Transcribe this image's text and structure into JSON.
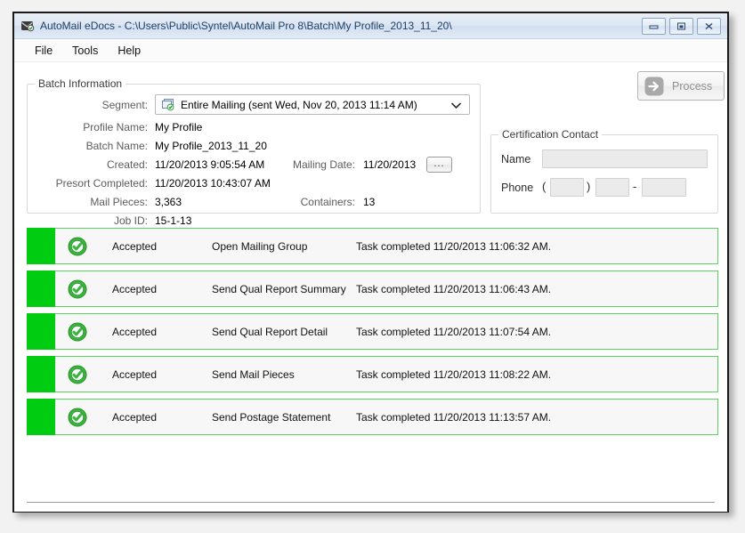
{
  "window": {
    "title": "AutoMail eDocs - C:\\Users\\Public\\Syntel\\AutoMail Pro 8\\Batch\\My Profile_2013_11_20\\",
    "app_icon": "automail-app-icon",
    "controls": {
      "minimize": "minimize-icon",
      "maximize": "restore-icon",
      "close": "close-icon"
    }
  },
  "menu": {
    "items": [
      {
        "label": "File"
      },
      {
        "label": "Tools"
      },
      {
        "label": "Help"
      }
    ]
  },
  "batch_information": {
    "title": "Batch Information",
    "segment": {
      "label": "Segment:",
      "icon": "mailing-segment-icon",
      "value": "Entire Mailing (sent Wed, Nov 20, 2013 11:14 AM)",
      "arrow_icon": "chevron-down-icon"
    },
    "fields": [
      {
        "label": "Profile Name:",
        "value": "My Profile"
      },
      {
        "label": "Batch Name:",
        "value": "My Profile_2013_11_20"
      },
      {
        "label": "Created:",
        "value": "11/20/2013 9:05:54 AM"
      },
      {
        "label": "Presort Completed:",
        "value": "11/20/2013 10:43:07 AM"
      },
      {
        "label": "Mail Pieces:",
        "value": "3,363"
      },
      {
        "label": "Job ID:",
        "value": "15-1-13"
      }
    ],
    "mailing_date": {
      "label": "Mailing Date:",
      "value": "11/20/2013",
      "browse_button": "..."
    },
    "containers": {
      "label": "Containers:",
      "value": "13"
    }
  },
  "process_button": {
    "label": "Process",
    "icon": "arrow-right-icon",
    "enabled": false
  },
  "certification_contact": {
    "title": "Certification Contact",
    "name": {
      "label": "Name",
      "value": "",
      "placeholder": ""
    },
    "phone": {
      "label": "Phone",
      "open_paren": "(",
      "close_paren": ")",
      "dash": "-",
      "area_code": "",
      "prefix": "",
      "line_number": ""
    }
  },
  "status_list": {
    "accent_color": "#00cc11",
    "border_color": "#5ecf63",
    "rows": [
      {
        "icon": "check-circle-icon",
        "status": "Accepted",
        "task": "Open Mailing Group",
        "detail": "Task completed 11/20/2013 11:06:32 AM."
      },
      {
        "icon": "check-circle-icon",
        "status": "Accepted",
        "task": "Send Qual Report Summary",
        "detail": "Task completed 11/20/2013 11:06:43 AM."
      },
      {
        "icon": "check-circle-icon",
        "status": "Accepted",
        "task": "Send Qual Report Detail",
        "detail": "Task completed 11/20/2013 11:07:54 AM."
      },
      {
        "icon": "check-circle-icon",
        "status": "Accepted",
        "task": "Send Mail Pieces",
        "detail": "Task completed 11/20/2013 11:08:22 AM."
      },
      {
        "icon": "check-circle-icon",
        "status": "Accepted",
        "task": "Send Postage Statement",
        "detail": "Task completed 11/20/2013 11:13:57 AM."
      }
    ]
  }
}
